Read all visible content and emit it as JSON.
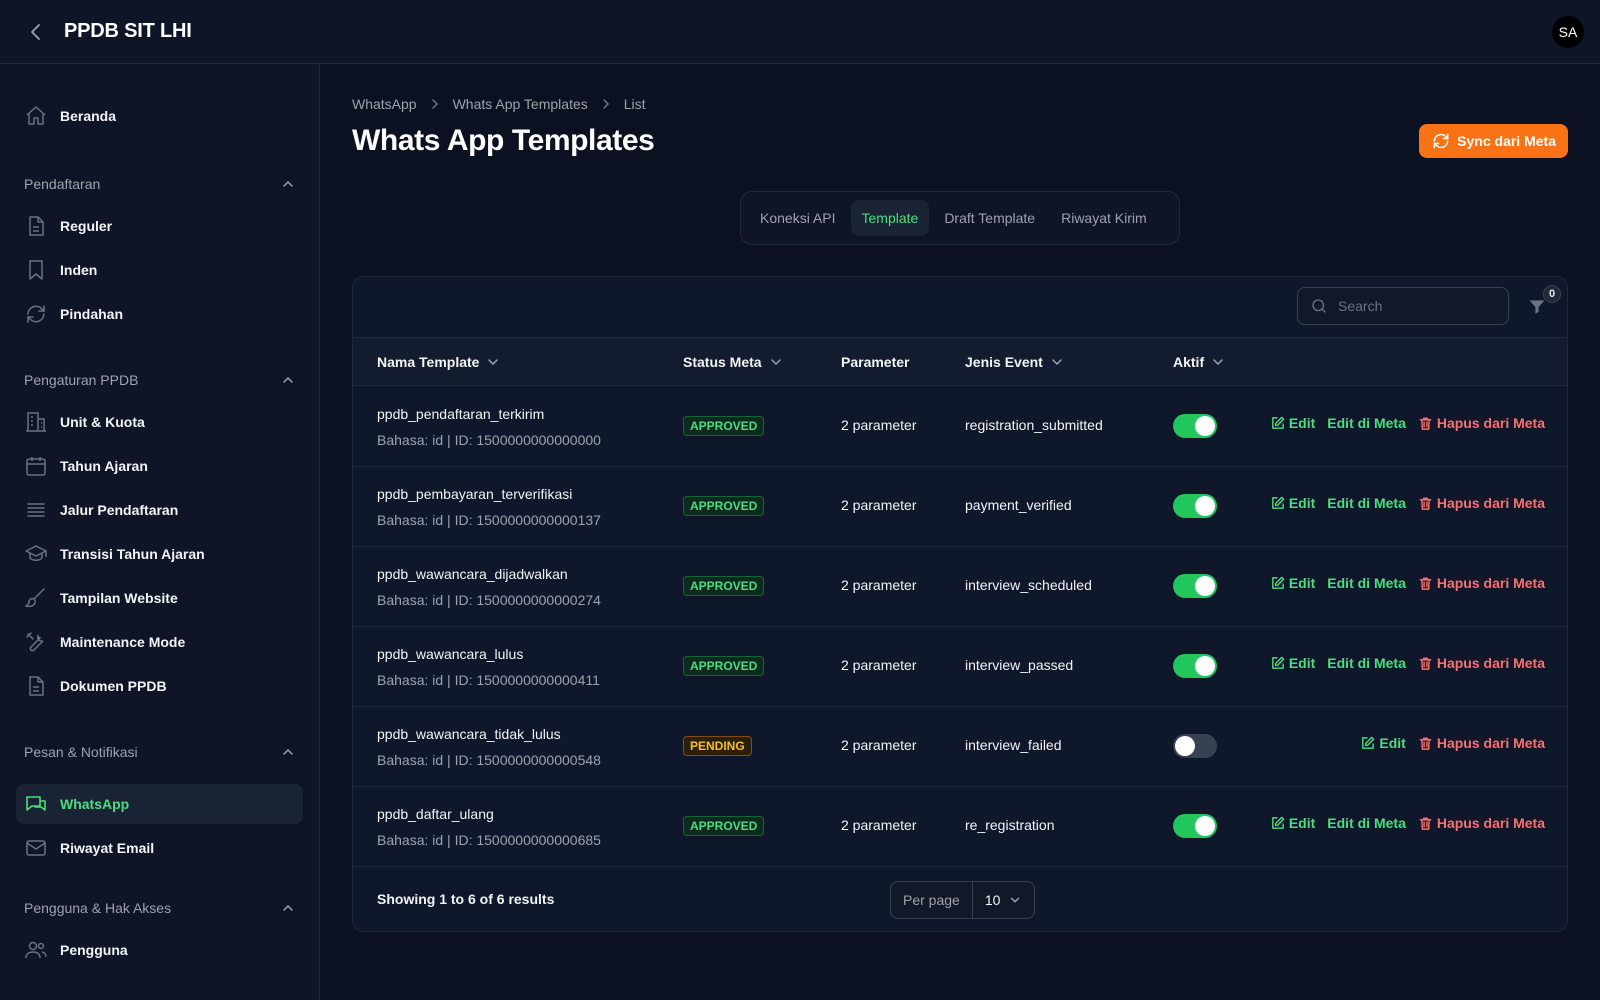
{
  "app": {
    "title": "PPDB SIT LHI",
    "avatar_initials": "SA"
  },
  "sidebar": {
    "home": {
      "label": "Beranda",
      "icon": "home-icon"
    },
    "groups": [
      {
        "label": "Pendaftaran",
        "items": [
          {
            "label": "Reguler",
            "icon": "document-icon"
          },
          {
            "label": "Inden",
            "icon": "bookmark-icon"
          },
          {
            "label": "Pindahan",
            "icon": "refresh-icon"
          }
        ]
      },
      {
        "label": "Pengaturan PPDB",
        "items": [
          {
            "label": "Unit & Kuota",
            "icon": "building-icon"
          },
          {
            "label": "Tahun Ajaran",
            "icon": "calendar-icon"
          },
          {
            "label": "Jalur Pendaftaran",
            "icon": "list-icon"
          },
          {
            "label": "Transisi Tahun Ajaran",
            "icon": "graduation-cap-icon"
          },
          {
            "label": "Tampilan Website",
            "icon": "brush-icon"
          },
          {
            "label": "Maintenance Mode",
            "icon": "wrench-icon"
          },
          {
            "label": "Dokumen PPDB",
            "icon": "document-icon"
          }
        ]
      },
      {
        "label": "Pesan & Notifikasi",
        "items": [
          {
            "label": "WhatsApp",
            "icon": "chat-bubbles-icon",
            "active": true
          },
          {
            "label": "Riwayat Email",
            "icon": "envelope-icon"
          }
        ]
      },
      {
        "label": "Pengguna & Hak Akses",
        "items": [
          {
            "label": "Pengguna",
            "icon": "users-icon"
          }
        ]
      }
    ]
  },
  "breadcrumb": [
    "WhatsApp",
    "Whats App Templates",
    "List"
  ],
  "page": {
    "title": "Whats App Templates",
    "sync_button": "Sync dari Meta"
  },
  "tabs": [
    {
      "label": "Koneksi API",
      "active": false
    },
    {
      "label": "Template",
      "active": true
    },
    {
      "label": "Draft Template",
      "active": false
    },
    {
      "label": "Riwayat Kirim",
      "active": false
    }
  ],
  "table": {
    "search_placeholder": "Search",
    "filter_count": "0",
    "columns": [
      "Nama Template",
      "Status Meta",
      "Parameter",
      "Jenis Event",
      "Aktif"
    ],
    "rows": [
      {
        "name": "ppdb_pendaftaran_terkirim",
        "meta": "Bahasa: id | ID: 1500000000000000",
        "status": "APPROVED",
        "param": "2 parameter",
        "event": "registration_submitted",
        "active": true,
        "actions": [
          "Edit",
          "Edit di Meta",
          "Hapus dari Meta"
        ]
      },
      {
        "name": "ppdb_pembayaran_terverifikasi",
        "meta": "Bahasa: id | ID: 1500000000000137",
        "status": "APPROVED",
        "param": "2 parameter",
        "event": "payment_verified",
        "active": true,
        "actions": [
          "Edit",
          "Edit di Meta",
          "Hapus dari Meta"
        ]
      },
      {
        "name": "ppdb_wawancara_dijadwalkan",
        "meta": "Bahasa: id | ID: 1500000000000274",
        "status": "APPROVED",
        "param": "2 parameter",
        "event": "interview_scheduled",
        "active": true,
        "actions": [
          "Edit",
          "Edit di Meta",
          "Hapus dari Meta"
        ]
      },
      {
        "name": "ppdb_wawancara_lulus",
        "meta": "Bahasa: id | ID: 1500000000000411",
        "status": "APPROVED",
        "param": "2 parameter",
        "event": "interview_passed",
        "active": true,
        "actions": [
          "Edit",
          "Edit di Meta",
          "Hapus dari Meta"
        ]
      },
      {
        "name": "ppdb_wawancara_tidak_lulus",
        "meta": "Bahasa: id | ID: 1500000000000548",
        "status": "PENDING",
        "param": "2 parameter",
        "event": "interview_failed",
        "active": false,
        "actions": [
          "Edit",
          "Hapus dari Meta"
        ]
      },
      {
        "name": "ppdb_daftar_ulang",
        "meta": "Bahasa: id | ID: 1500000000000685",
        "status": "APPROVED",
        "param": "2 parameter",
        "event": "re_registration",
        "active": true,
        "actions": [
          "Edit",
          "Edit di Meta",
          "Hapus dari Meta"
        ]
      }
    ],
    "footer": {
      "results": "Showing 1 to 6 of 6 results",
      "per_page_label": "Per page",
      "per_page_value": "10"
    }
  },
  "colors": {
    "accent_green": "#4ade80",
    "toggle_on": "#22c55e",
    "sync_orange": "#f97316",
    "danger_red": "#f87171",
    "pending_amber": "#fbbf24"
  }
}
